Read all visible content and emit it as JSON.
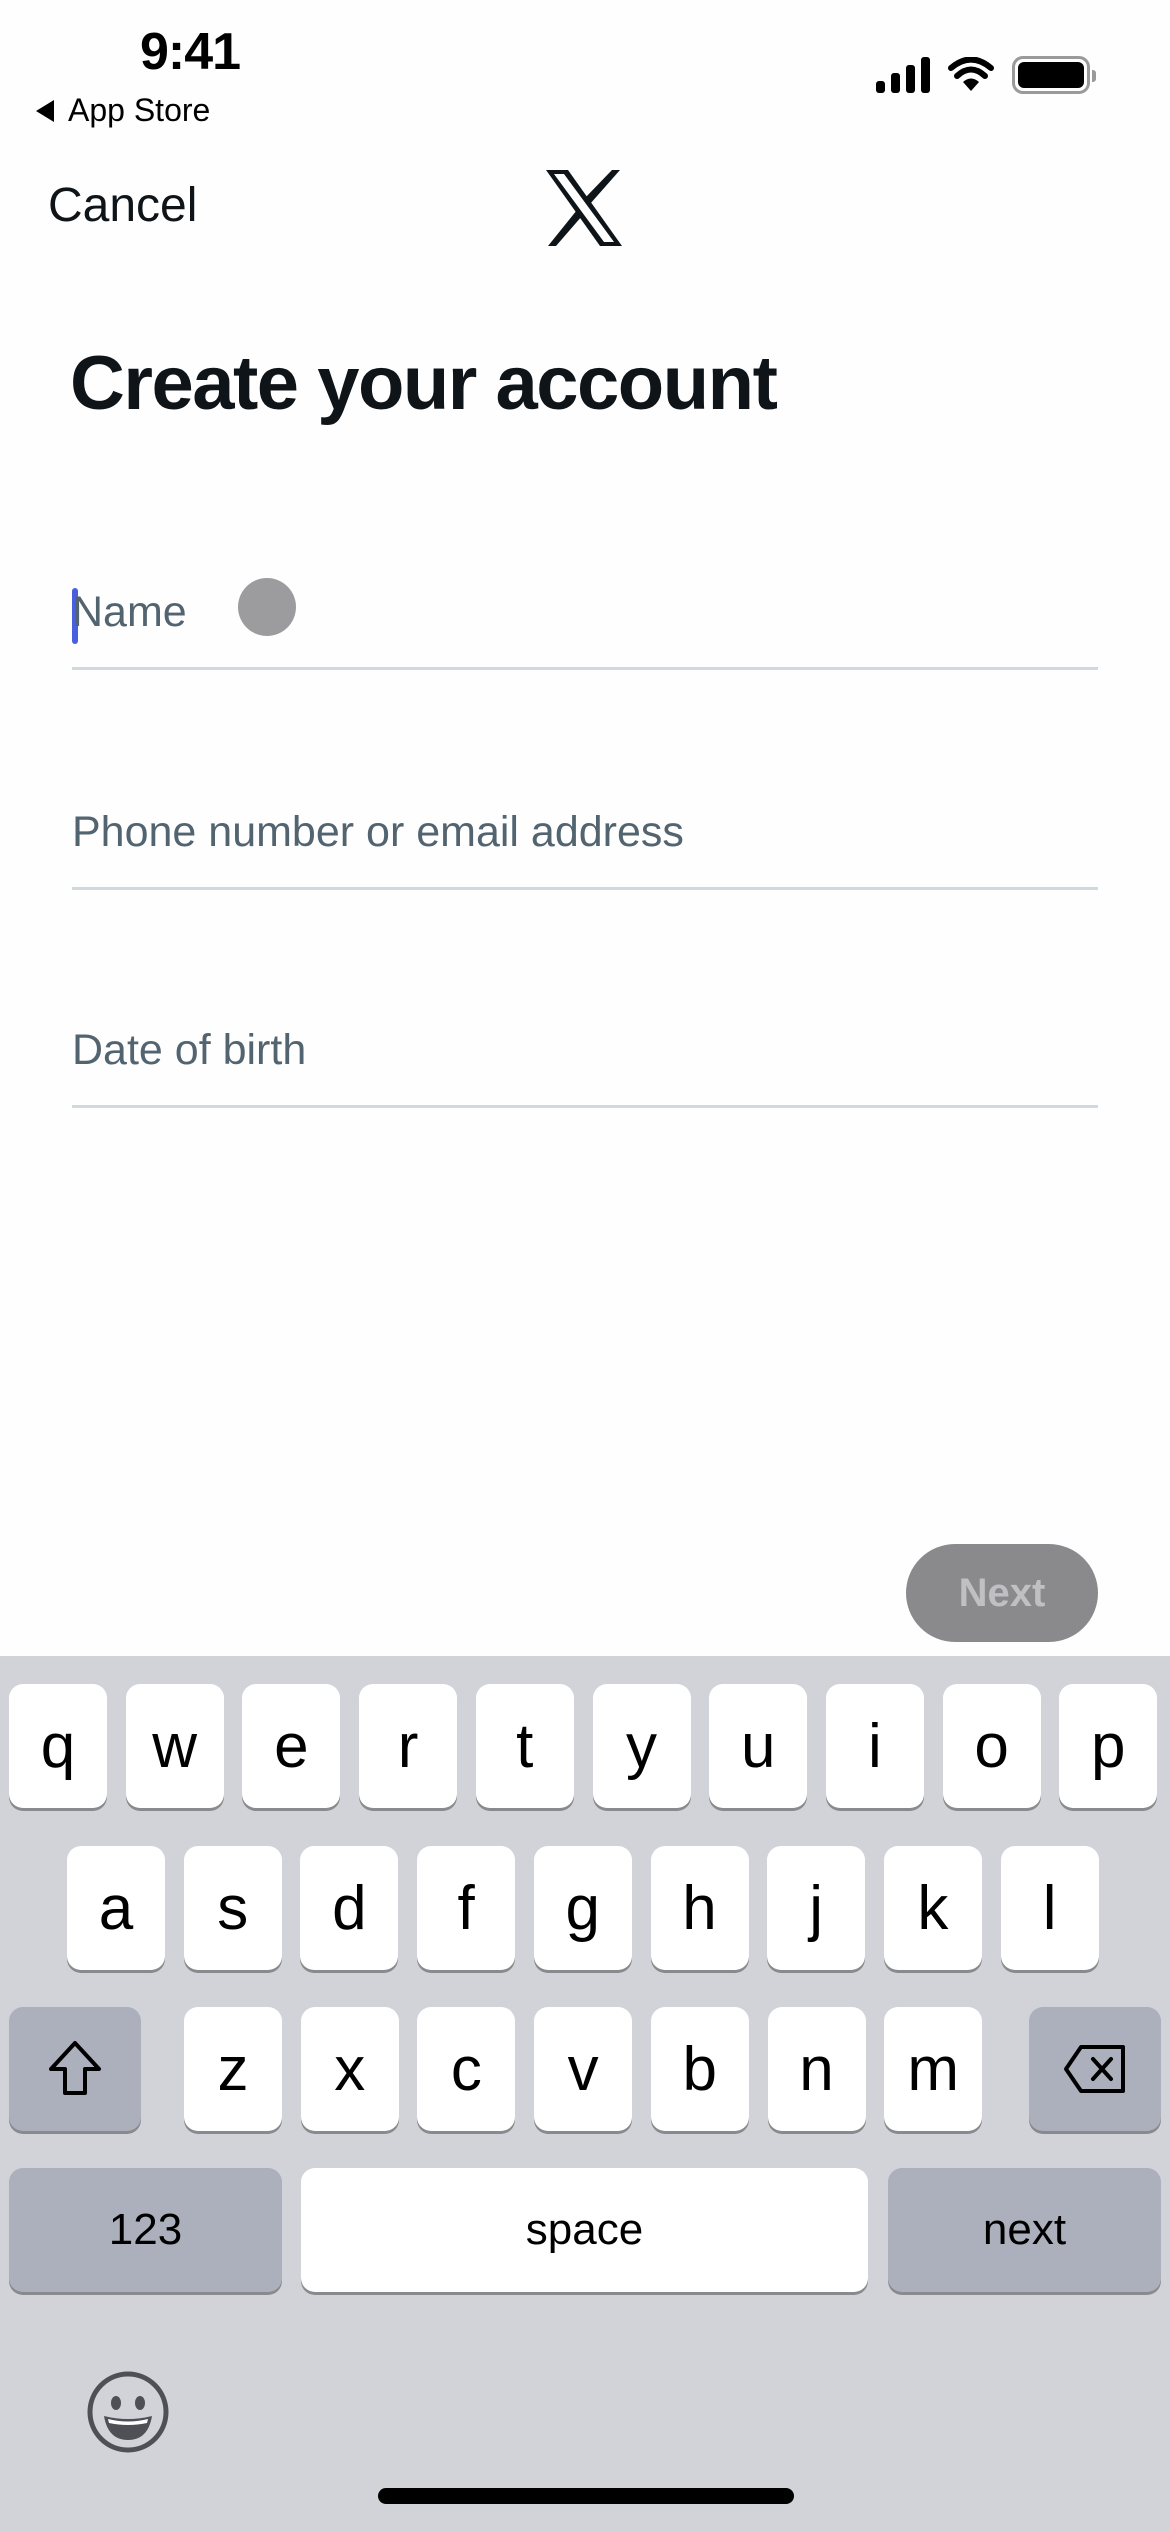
{
  "status_bar": {
    "time": "9:41",
    "back_app": "App Store",
    "icons": [
      "signal-icon",
      "wifi-icon",
      "battery-icon"
    ]
  },
  "nav": {
    "cancel_label": "Cancel",
    "logo": "x-logo-icon"
  },
  "page": {
    "title": "Create your account"
  },
  "form": {
    "name": {
      "value": "",
      "placeholder": "Name"
    },
    "contact": {
      "value": "",
      "placeholder": "Phone number or email address"
    },
    "dob": {
      "value": "",
      "placeholder": "Date of birth"
    }
  },
  "next_label": "Next",
  "keyboard": {
    "row1": [
      "q",
      "w",
      "e",
      "r",
      "t",
      "y",
      "u",
      "i",
      "o",
      "p"
    ],
    "row2": [
      "a",
      "s",
      "d",
      "f",
      "g",
      "h",
      "j",
      "k",
      "l"
    ],
    "row3": [
      "z",
      "x",
      "c",
      "v",
      "b",
      "n",
      "m"
    ],
    "numbers_label": "123",
    "space_label": "space",
    "return_label": "next"
  },
  "colors": {
    "caret": "#4a5fdd",
    "next_button_disabled": "#8a8a8d",
    "keyboard_bg": "#d1d3d9"
  }
}
